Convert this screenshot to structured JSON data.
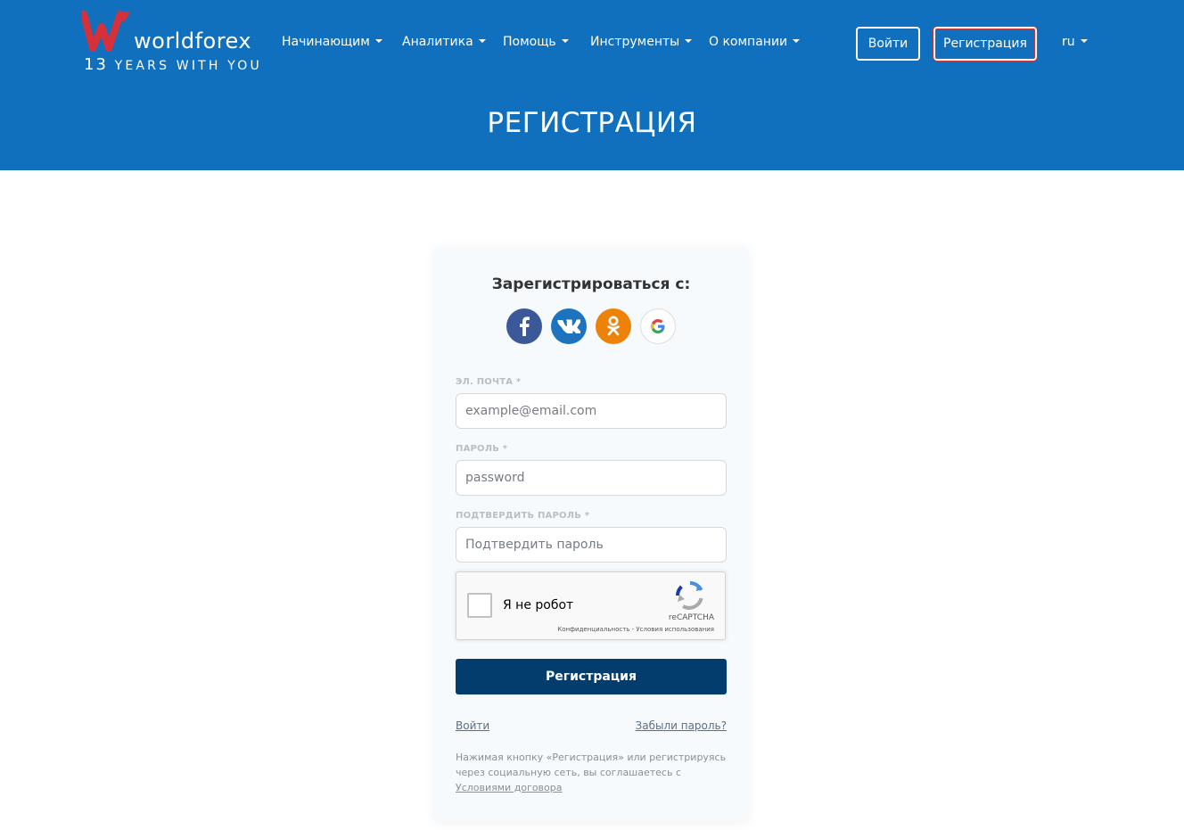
{
  "header": {
    "brand": "worldforex",
    "tagline_number": "13",
    "tagline_text": "YEARS WITH YOU",
    "nav": [
      {
        "label": "Начинающим"
      },
      {
        "label": "Аналитика"
      },
      {
        "label": "Помощь"
      },
      {
        "label": "Инструменты"
      },
      {
        "label": "О компании"
      }
    ],
    "login_label": "Войти",
    "register_label": "Регистрация",
    "language": "ru",
    "page_title": "РЕГИСТРАЦИЯ",
    "colors": {
      "background": "#1170bd",
      "logo_accent": "#d6313a"
    }
  },
  "form": {
    "social_title": "Зарегистрироваться с:",
    "social": [
      {
        "icon": "facebook-icon",
        "color": "#3b5998"
      },
      {
        "icon": "vk-icon",
        "color": "#1e73be"
      },
      {
        "icon": "odnoklassniki-icon",
        "color": "#ee8208"
      },
      {
        "icon": "google-icon",
        "color": "#ffffff"
      }
    ],
    "email_label": "ЭЛ. ПОЧТА *",
    "email_placeholder": "example@email.com",
    "password_label": "ПАРОЛЬ *",
    "password_placeholder": "password",
    "confirm_label": "ПОДТВЕРДИТЬ ПАРОЛЬ *",
    "confirm_placeholder": "Подтвердить пароль",
    "captcha": {
      "text": "Я не робот",
      "brand": "reCAPTCHA",
      "links": "Конфиденциальность - Условия использования"
    },
    "submit_label": "Регистрация",
    "login_link": "Войти",
    "forgot_link": "Забыли пароль?",
    "terms_text": "Нажимая кнопку «Регистрация» или регистрируясь через социальную сеть, вы соглашаетесь с",
    "terms_link": "Условиями договора",
    "submit_color": "#023d6d"
  }
}
